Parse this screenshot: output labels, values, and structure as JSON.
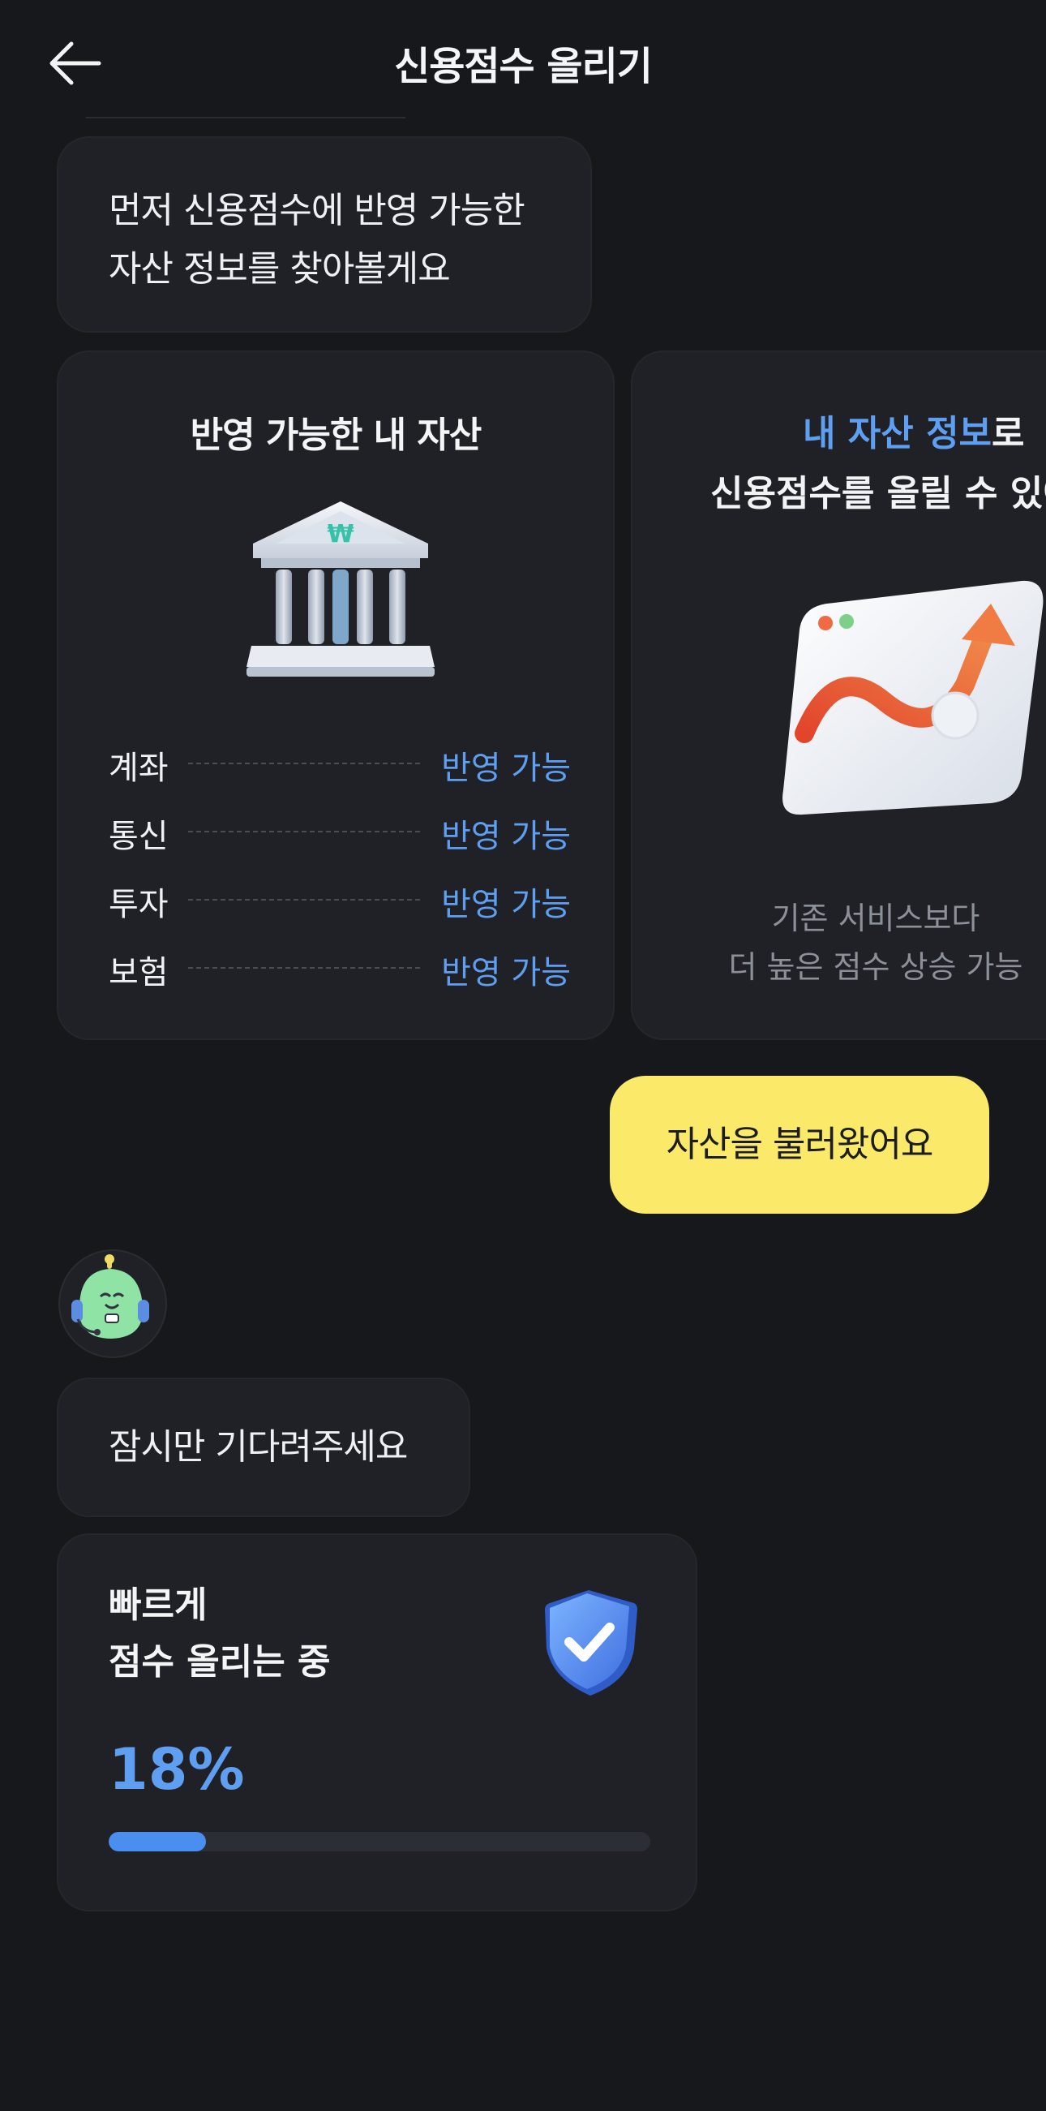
{
  "header": {
    "title": "신용점수 올리기",
    "back_icon": "arrow-left-icon"
  },
  "intro_message": {
    "line1": "먼저 신용점수에 반영 가능한",
    "line2": "자산 정보를 찾아볼게요"
  },
  "assets_card": {
    "title": "반영 가능한 내 자산",
    "icon": "bank-icon",
    "rows": [
      {
        "name": "계좌",
        "status": "반영 가능"
      },
      {
        "name": "통신",
        "status": "반영 가능"
      },
      {
        "name": "투자",
        "status": "반영 가능"
      },
      {
        "name": "보험",
        "status": "반영 가능"
      }
    ]
  },
  "promo_card": {
    "highlight": "내 자산 정보",
    "line1_suffix": "로",
    "line2": "신용점수를 올릴 수 있어",
    "icon": "growth-chart-icon",
    "desc_line1": "기존 서비스보다",
    "desc_line2": "더 높은 점수 상승 가능"
  },
  "user_message": {
    "text": "자산을 불러왔어요"
  },
  "bot": {
    "avatar_icon": "assistant-avatar-icon"
  },
  "wait_message": {
    "text": "잠시만 기다려주세요"
  },
  "progress_card": {
    "title_line1": "빠르게",
    "title_line2": "점수 올리는 중",
    "icon": "shield-check-icon",
    "percent_label": "18%",
    "progress": 0.18
  },
  "colors": {
    "background": "#17181c",
    "card": "#202127",
    "accent": "#5f9ff2",
    "user_bubble": "#fbea6a"
  }
}
